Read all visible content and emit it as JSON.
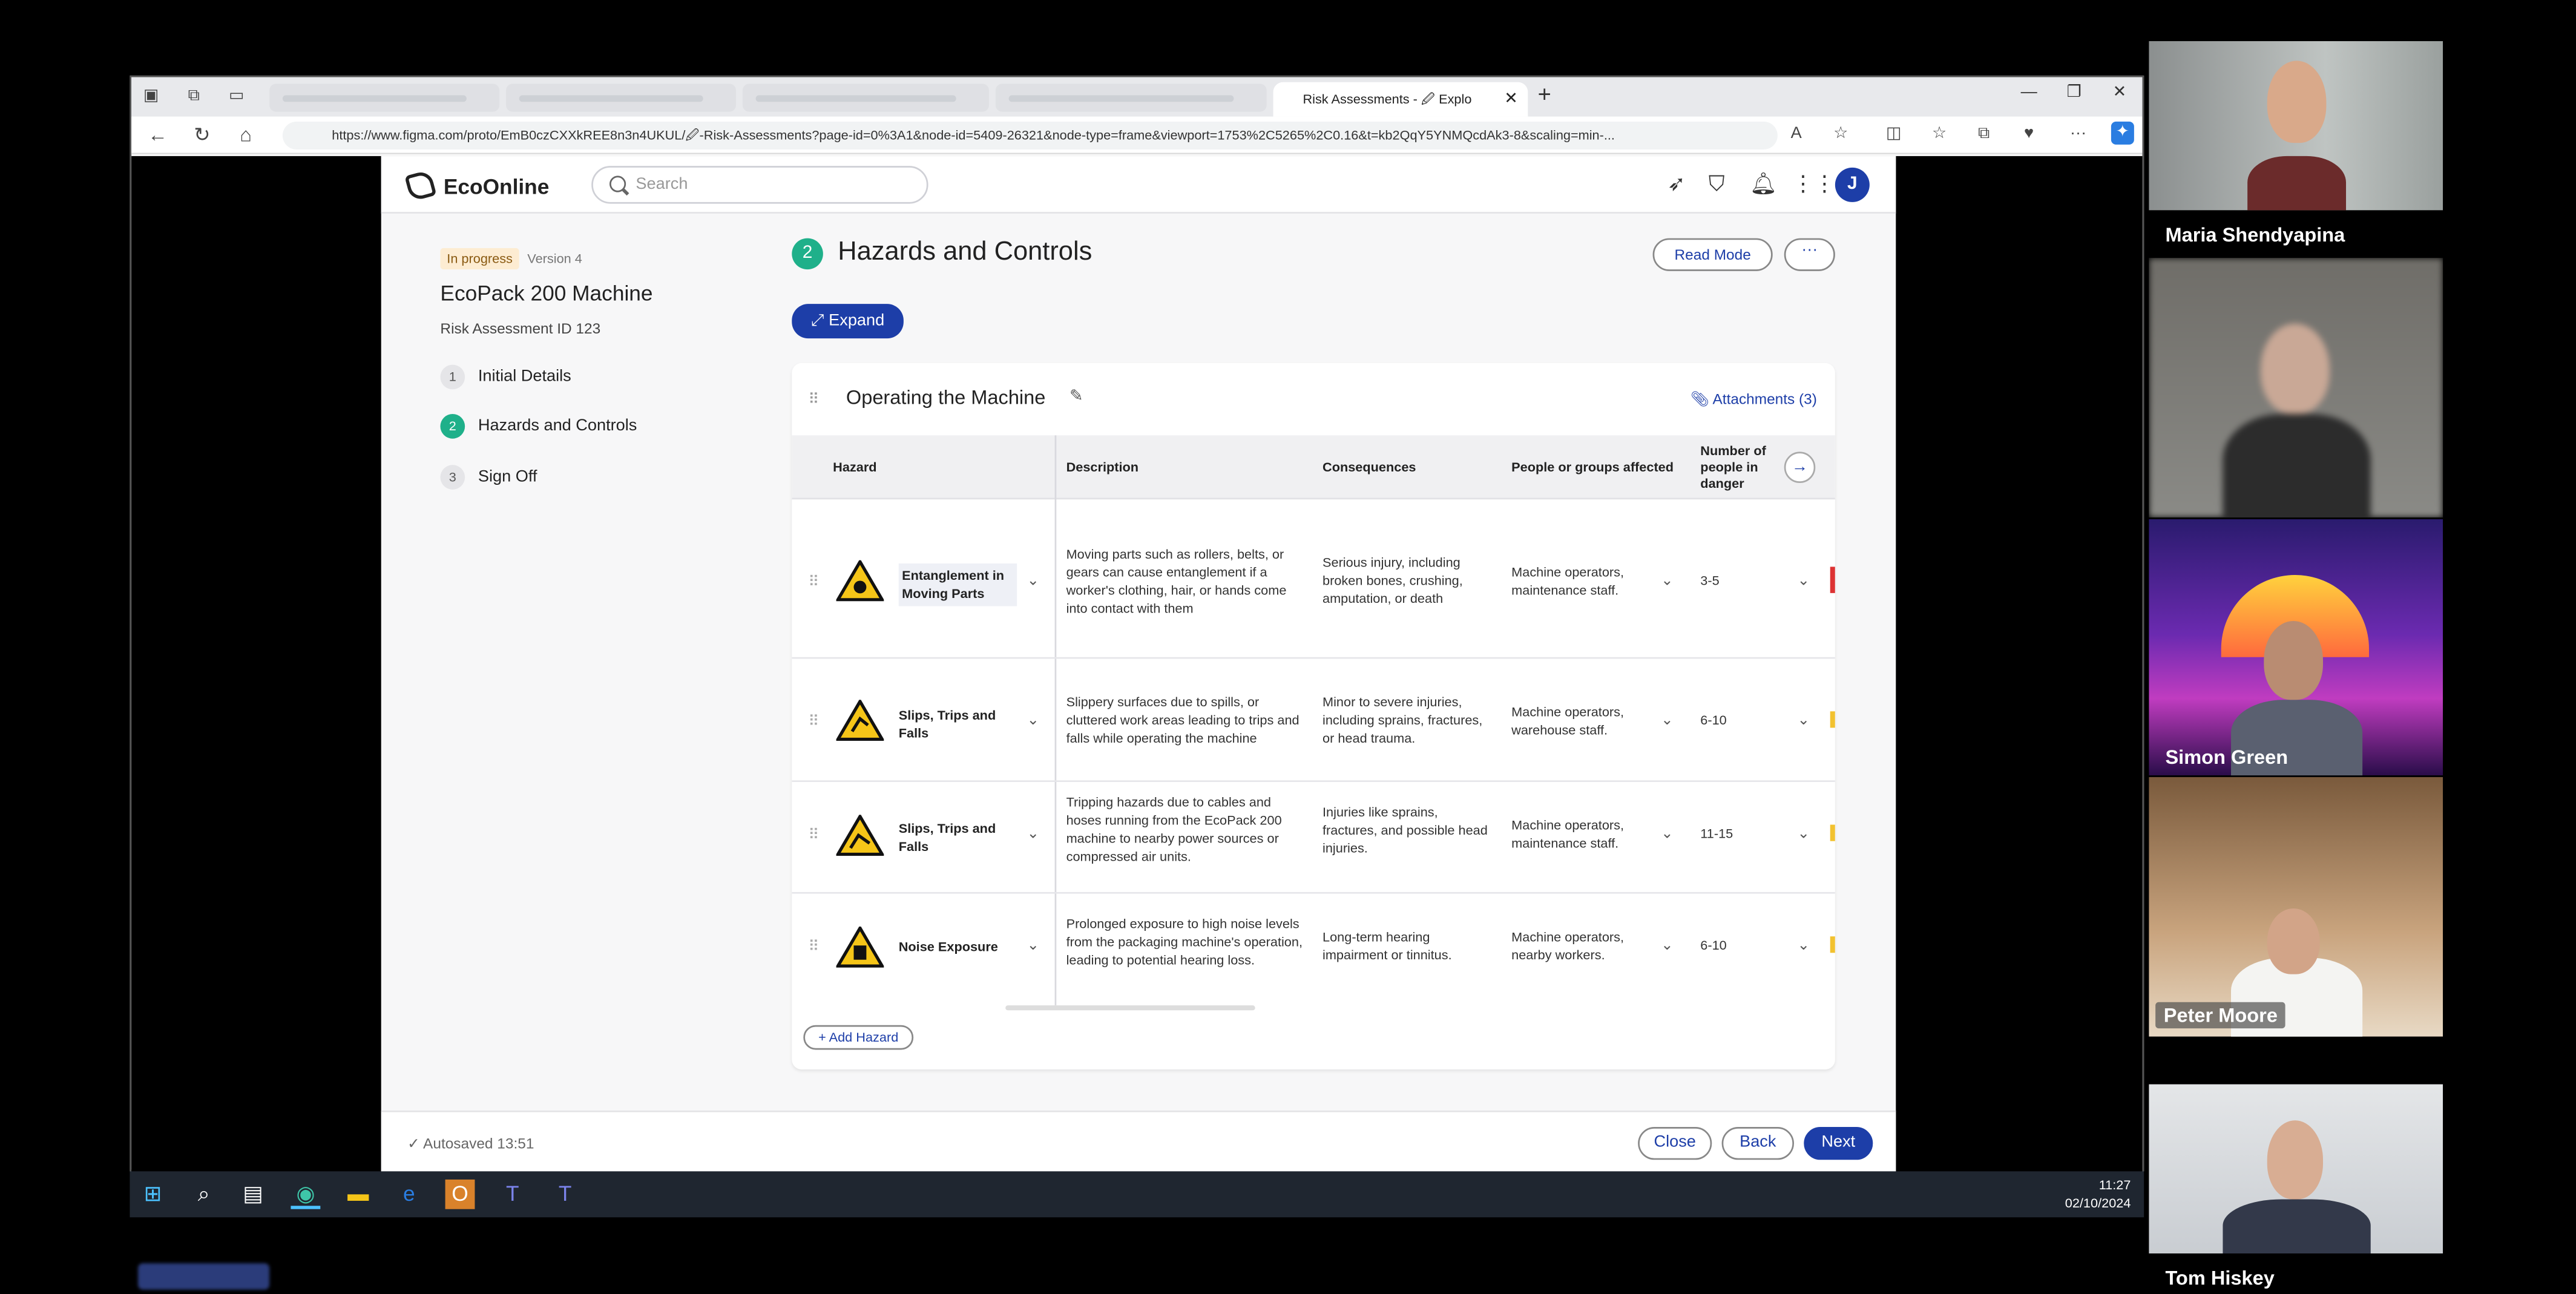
{
  "browser": {
    "active_tab_title": "Risk Assessments - 🖉 Explo",
    "url": "https://www.figma.com/proto/EmB0czCXXkREE8n3n4UKUL/🖉-Risk-Assessments?page-id=0%3A1&node-id=5409-26321&node-type=frame&viewport=1753%2C5265%2C0.16&t=kb2QqY5YNMQcdAk3-8&scaling=min-..."
  },
  "app": {
    "brand": "EcoOnline",
    "search_placeholder": "Search",
    "avatar_letter": "J"
  },
  "left_panel": {
    "status_badge": "In progress",
    "version": "Version 4",
    "title": "EcoPack 200 Machine",
    "assessment_id": "Risk Assessment ID 123",
    "steps": [
      {
        "num": "1",
        "label": "Initial Details"
      },
      {
        "num": "2",
        "label": "Hazards and Controls"
      },
      {
        "num": "3",
        "label": "Sign Off"
      }
    ]
  },
  "main": {
    "section_num": "2",
    "section_title": "Hazards and Controls",
    "read_mode": "Read Mode",
    "more": "···",
    "expand": "Expand",
    "card_title": "Operating the Machine",
    "attachments": "Attachments (3)",
    "columns": [
      "Hazard",
      "Description",
      "Consequences",
      "People or groups affected",
      "Number of people in danger"
    ],
    "rows": [
      {
        "hazard": "Entanglement in Moving Parts",
        "description": "Moving parts such as rollers, belts, or gears can cause entanglement if a worker's clothing, hair, or hands come into contact with them",
        "consequences": "Serious injury, including broken bones, crushing, amputation, or death",
        "people": "Machine operators, maintenance staff.",
        "number": "3-5"
      },
      {
        "hazard": "Slips, Trips and Falls",
        "description": "Slippery surfaces due to spills, or cluttered work areas leading to trips and falls while operating the machine",
        "consequences": "Minor to severe injuries, including sprains, fractures, or head trauma.",
        "people": "Machine operators, warehouse staff.",
        "number": "6-10"
      },
      {
        "hazard": "Slips, Trips and Falls",
        "description": "Tripping hazards due to cables and hoses running from the EcoPack 200 machine to nearby power sources or compressed air units.",
        "consequences": "Injuries like sprains, fractures, and possible head injuries.",
        "people": "Machine operators, maintenance staff.",
        "number": "11-15"
      },
      {
        "hazard": "Noise Exposure",
        "description": "Prolonged exposure to high noise levels from the packaging machine's operation, leading to potential hearing loss.",
        "consequences": "Long-term hearing impairment or tinnitus.",
        "people": "Machine operators, nearby workers.",
        "number": "6-10"
      }
    ],
    "add_hazard": "+ Add Hazard"
  },
  "footer": {
    "autosaved": "Autosaved 13:51",
    "close": "Close",
    "back": "Back",
    "next": "Next"
  },
  "taskbar": {
    "time": "11:27",
    "date": "02/10/2024"
  },
  "participants": [
    {
      "name": "Maria Shendyapina"
    },
    {
      "name": ""
    },
    {
      "name": "Simon Green"
    },
    {
      "name": "Peter Moore"
    },
    {
      "name": "Tom Hiskey"
    }
  ],
  "colors": {
    "brand_blue": "#1d3ea8",
    "step_green": "#1fb08a",
    "status_bg": "#fdecd2"
  }
}
